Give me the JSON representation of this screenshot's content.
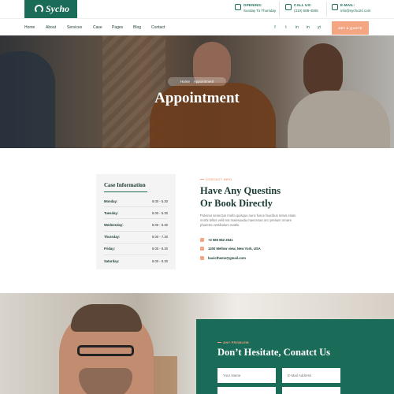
{
  "brand": {
    "name": "Sycho"
  },
  "topbar": {
    "opening": {
      "label": "OPENING:",
      "value": "Sunday To Thursday"
    },
    "call": {
      "label": "CALL US:",
      "value": "(310) 588-4506"
    },
    "email": {
      "label": "E-MAIL:",
      "value": "info@sycho24.com"
    }
  },
  "nav": {
    "items": [
      "Home",
      "About",
      "Services",
      "Case",
      "Pages",
      "Blog",
      "Contact"
    ],
    "social": [
      "f",
      "t",
      "in",
      "in",
      "yt"
    ],
    "cta": "GET A QUOTE"
  },
  "hero": {
    "breadcrumb": [
      "Home",
      "Appointment"
    ],
    "title": "Appointment"
  },
  "case_info": {
    "title": "Case Information",
    "rows": [
      {
        "day": "Monday:",
        "time": "8.00 - 5.30"
      },
      {
        "day": "Tuesday:",
        "time": "8.00 - 5.30"
      },
      {
        "day": "Wednesday:",
        "time": "8.00 - 5.30"
      },
      {
        "day": "Thursday:",
        "time": "8.00 - 7.30"
      },
      {
        "day": "Friday:",
        "time": "8.00 - 6.30"
      },
      {
        "day": "Saturday:",
        "time": "8.00 - 5.30"
      }
    ]
  },
  "contact": {
    "kicker": "CONTACT INFO",
    "title_line1": "Have Any Questins",
    "title_line2": "Or Book Directly",
    "paragraph": "Pulvinar senectus morbi quisque nunc fusce faucibus netus etiam morbi tellus velit nisi malesuada maecenas orci pretium ornare pharetra vestibulum mattis.",
    "phone": "+2 565 552 2541",
    "address": "1200 Mellow view, New York, USA",
    "email": "basictheme@gmail.com"
  },
  "form": {
    "kicker": "ANY PROBLEM",
    "title": "Don’t Hesitate, Conatct Us",
    "name_placeholder": "Your Name",
    "email_placeholder": "E-Mail Address"
  },
  "colors": {
    "primary": "#1a6b57",
    "accent": "#f4a582",
    "dark": "#1a3b33"
  }
}
